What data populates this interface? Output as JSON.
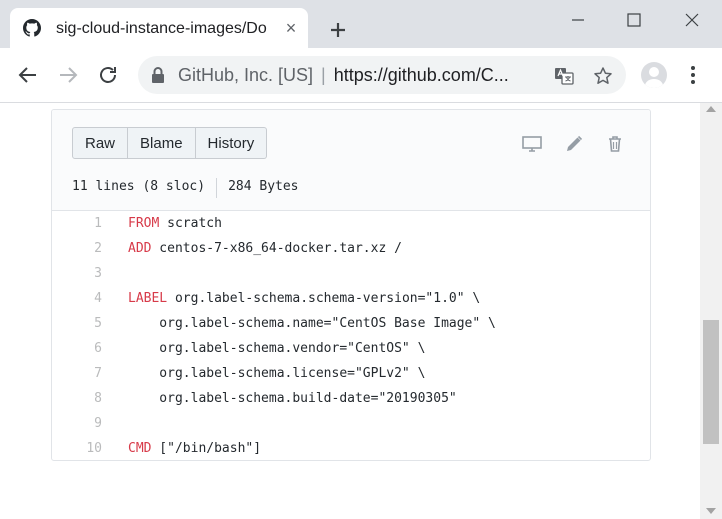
{
  "browser": {
    "tab": {
      "title": "sig-cloud-instance-images/Do",
      "favicon": "github-icon",
      "close": "×"
    },
    "address": {
      "org": "GitHub, Inc. [US]",
      "separator": "|",
      "url": "https://github.com/C..."
    }
  },
  "file": {
    "buttons": {
      "raw": "Raw",
      "blame": "Blame",
      "history": "History"
    },
    "lines_info": "11 lines (8 sloc)",
    "size": "284 Bytes",
    "code": [
      {
        "n": "1",
        "kw": "FROM",
        "rest": " scratch"
      },
      {
        "n": "2",
        "kw": "ADD",
        "rest": " centos-7-x86_64-docker.tar.xz /"
      },
      {
        "n": "3",
        "kw": "",
        "rest": ""
      },
      {
        "n": "4",
        "kw": "LABEL",
        "rest": " org.label-schema.schema-version=\"1.0\" \\"
      },
      {
        "n": "5",
        "kw": "",
        "rest": "    org.label-schema.name=\"CentOS Base Image\" \\"
      },
      {
        "n": "6",
        "kw": "",
        "rest": "    org.label-schema.vendor=\"CentOS\" \\"
      },
      {
        "n": "7",
        "kw": "",
        "rest": "    org.label-schema.license=\"GPLv2\" \\"
      },
      {
        "n": "8",
        "kw": "",
        "rest": "    org.label-schema.build-date=\"20190305\""
      },
      {
        "n": "9",
        "kw": "",
        "rest": ""
      },
      {
        "n": "10",
        "kw": "CMD",
        "rest": " [\"/bin/bash\"]"
      }
    ]
  },
  "colors": {
    "keyword": "#d73a49",
    "line_number": "#babbbc",
    "tabbar": "#dee1e6"
  }
}
